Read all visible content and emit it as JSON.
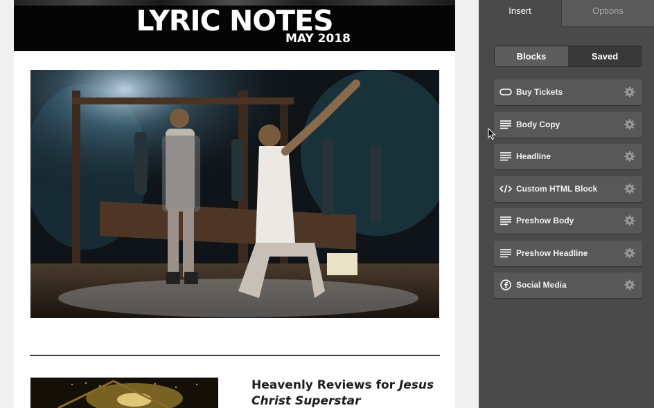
{
  "email": {
    "banner_title": "LYRIC NOTES",
    "banner_subtitle": "MAY 2018",
    "article_title_plain": "Heavenly Reviews for ",
    "article_title_italic": "Jesus Christ Superstar"
  },
  "panel": {
    "tabs": [
      {
        "label": "Insert",
        "active": true
      },
      {
        "label": "Options",
        "active": false
      }
    ],
    "segments": [
      {
        "label": "Blocks",
        "active": false
      },
      {
        "label": "Saved",
        "active": true
      }
    ],
    "blocks": [
      {
        "label": "Buy Tickets",
        "icon": "button-pill-icon"
      },
      {
        "label": "Body Copy",
        "icon": "text-lines-icon"
      },
      {
        "label": "Headline",
        "icon": "text-lines-icon"
      },
      {
        "label": "Custom HTML Block",
        "icon": "code-icon"
      },
      {
        "label": "Preshow Body",
        "icon": "text-lines-icon"
      },
      {
        "label": "Preshow Headline",
        "icon": "text-lines-icon"
      },
      {
        "label": "Social Media",
        "icon": "facebook-icon"
      }
    ]
  },
  "colors": {
    "panel_bg": "#4a4a4a",
    "block_bg": "#585858",
    "banner_bg": "#050505"
  }
}
